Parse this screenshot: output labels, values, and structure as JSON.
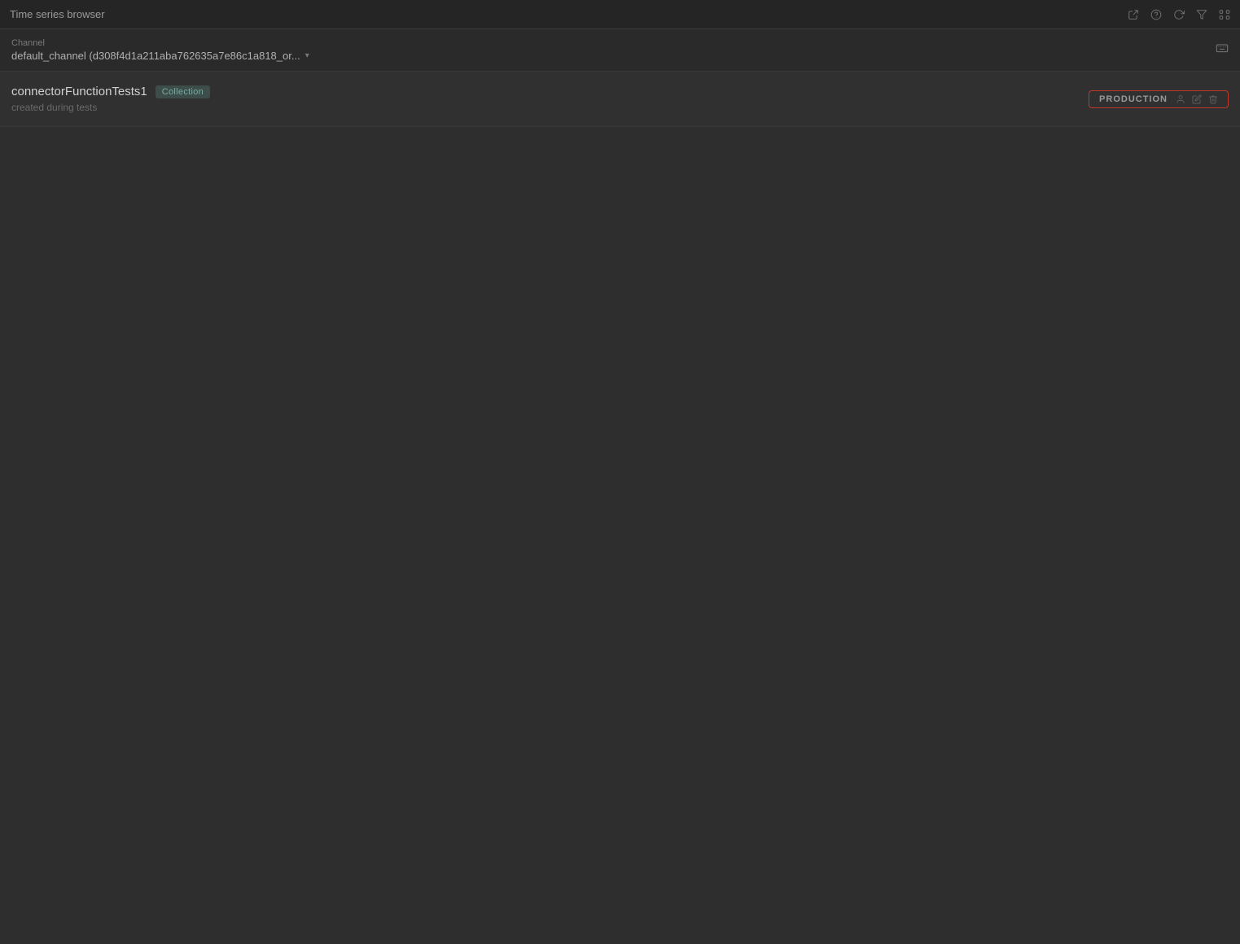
{
  "window": {
    "title": "Time series browser"
  },
  "topbar": {
    "title": "Time series browser",
    "icons": [
      "export-icon",
      "help-icon",
      "refresh-icon",
      "filter-icon",
      "settings-icon"
    ]
  },
  "channel": {
    "label": "Channel",
    "value": "default_channel (d308f4d1a211aba762635a7e86c1a818_or...",
    "keyboard_icon": "keyboard-shortcut-icon"
  },
  "item": {
    "title": "connectorFunctionTests1",
    "badge": "Collection",
    "subtitle": "created during tests",
    "environment": {
      "label": "PRODUCTION",
      "icons": [
        "person-icon",
        "edit-icon",
        "delete-icon"
      ]
    }
  }
}
